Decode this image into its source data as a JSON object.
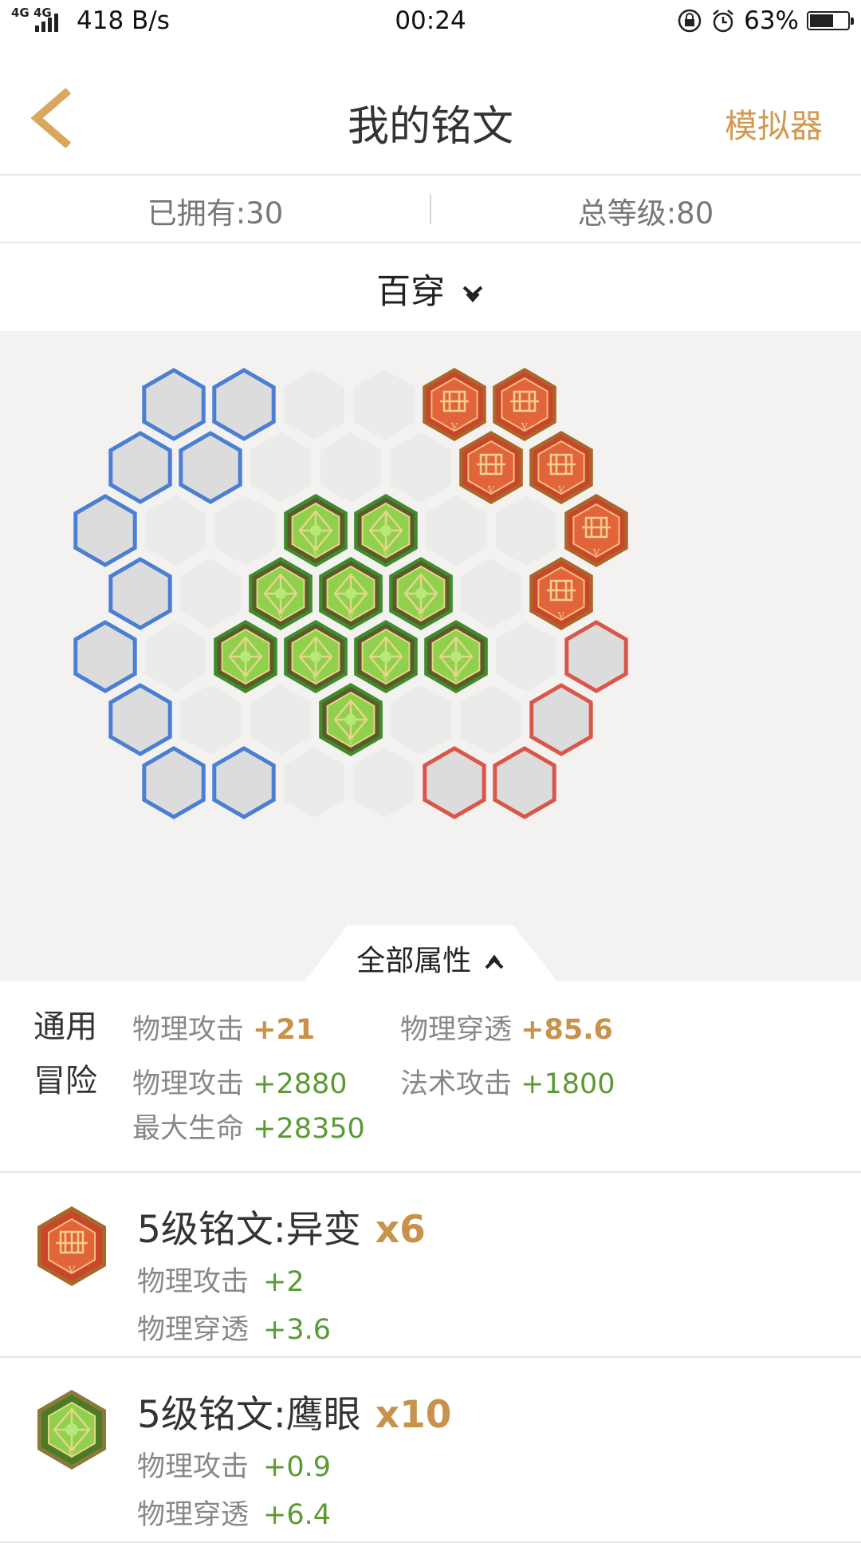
{
  "status_bar": {
    "network": "4G 4G",
    "speed": "418 B/s",
    "time": "00:24",
    "battery": "63%",
    "battery_level": 0.63
  },
  "header": {
    "title": "我的铭文",
    "right_action": "模拟器"
  },
  "stats": {
    "owned": "已拥有:30",
    "total_level": "总等级:80"
  },
  "page_selector": {
    "name": "百穿"
  },
  "board": {
    "colors": {
      "blue": "#4a7fd3",
      "red": "#d9574a",
      "green": "#3e8c2c",
      "empty": "#dcdcdc",
      "faint": "#ebebea"
    },
    "rows": [
      [
        "blue",
        "blue",
        "faint",
        "faint",
        "red_rune",
        "red_rune"
      ],
      [
        "blue",
        "blue",
        "faint",
        "faint",
        "faint",
        "red_rune",
        "red_rune"
      ],
      [
        "blue",
        "faint",
        "faint",
        "green_rune",
        "green_rune",
        "faint",
        "faint",
        "red_rune"
      ],
      [
        "blue",
        "faint",
        "green_rune",
        "green_rune",
        "green_rune",
        "faint",
        "red_rune"
      ],
      [
        "blue",
        "faint",
        "green_rune",
        "green_rune",
        "green_rune",
        "green_rune",
        "faint",
        "red"
      ],
      [
        "blue",
        "faint",
        "faint",
        "green_rune",
        "faint",
        "faint",
        "red"
      ],
      [
        "blue",
        "blue",
        "faint",
        "faint",
        "red",
        "red"
      ]
    ]
  },
  "attributes_tab": {
    "label": "全部属性"
  },
  "attributes": {
    "general_label": "通用",
    "adventure_label": "冒险",
    "general": [
      {
        "name": "物理攻击",
        "value": "+21"
      },
      {
        "name": "物理穿透",
        "value": "+85.6"
      }
    ],
    "adventure": [
      {
        "name": "物理攻击",
        "value": "+2880"
      },
      {
        "name": "法术攻击",
        "value": "+1800"
      },
      {
        "name": "最大生命",
        "value": "+28350"
      }
    ]
  },
  "runes": [
    {
      "name": "5级铭文:异变",
      "count": "x6",
      "icon": "red-rune-icon",
      "stats": [
        {
          "name": "物理攻击",
          "value": "+2"
        },
        {
          "name": "物理穿透",
          "value": "+3.6"
        }
      ]
    },
    {
      "name": "5级铭文:鹰眼",
      "count": "x10",
      "icon": "green-rune-icon",
      "stats": [
        {
          "name": "物理攻击",
          "value": "+0.9"
        },
        {
          "name": "物理穿透",
          "value": "+6.4"
        }
      ]
    }
  ]
}
